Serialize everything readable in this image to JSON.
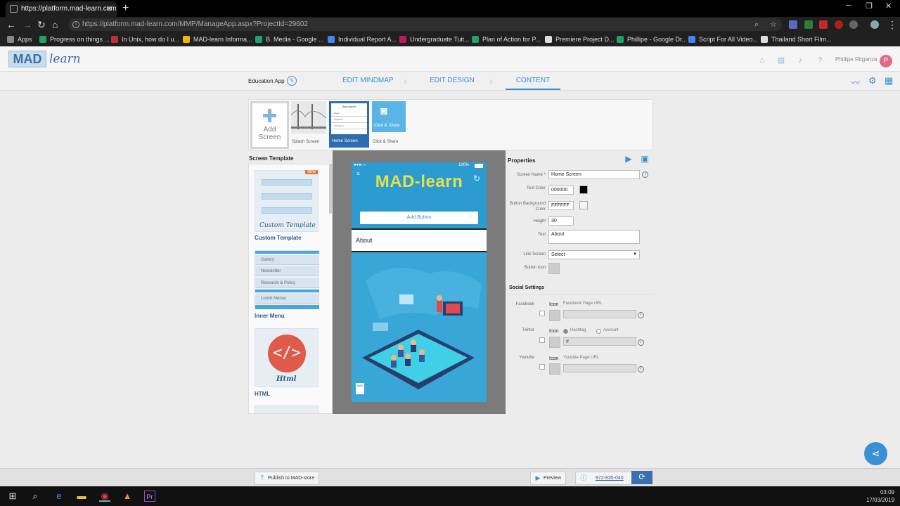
{
  "browser": {
    "tab_title": "https://platform.mad-learn.com/",
    "url": "https://platform.mad-learn.com/MMP/ManageApp.aspx?ProjectId=29602",
    "bookmarks": [
      {
        "label": "Apps",
        "color": "#888888"
      },
      {
        "label": "Progress on things ...",
        "color": "#1fa463"
      },
      {
        "label": "In Unix, how do I u...",
        "color": "#c03030"
      },
      {
        "label": "MAD-learn Informa...",
        "color": "#f4b400"
      },
      {
        "label": "B. Media - Google ...",
        "color": "#1fa463"
      },
      {
        "label": "Individual Report A...",
        "color": "#4285f4"
      },
      {
        "label": "Undergraduate Tuit...",
        "color": "#c2185b"
      },
      {
        "label": "Plan of Action for P...",
        "color": "#1fa463"
      },
      {
        "label": "Premiere Project D...",
        "color": "#dddddd"
      },
      {
        "label": "Phillipe - Google Dr...",
        "color": "#1fa463"
      },
      {
        "label": "Script For All Video...",
        "color": "#4285f4"
      },
      {
        "label": "Thailand Short Film...",
        "color": "#dddddd"
      }
    ]
  },
  "header": {
    "logo_mad": "MAD",
    "logo_learn": "learn",
    "user_name": "Phillipe Ritganza",
    "user_initial": "P"
  },
  "nav": {
    "app_name": "Education App",
    "steps": [
      "EDIT MINDMAP",
      "EDIT DESIGN",
      "CONTENT"
    ],
    "active_step": "CONTENT"
  },
  "screens": {
    "add_label": "Add Screen",
    "items": [
      {
        "caption": "Splash Screen"
      },
      {
        "caption": "Home Screen",
        "selected": true,
        "thumb_title": "App Name",
        "thumb_items": [
          "About",
          "Programs",
          "Contact Us"
        ]
      },
      {
        "caption": "Click & Share",
        "thumb_title": "Click & Share"
      }
    ]
  },
  "templates": {
    "heading": "Screen Template",
    "new_badge": "NEW",
    "custom_thumb_text": "Custom Template",
    "custom_label": "Custom Template",
    "inner_menu_items": [
      "Gallery",
      "Newsletter",
      "Research & Policy",
      "Lunch Menus"
    ],
    "inner_menu_label": "Inner Menu",
    "html_thumb_text": "Html",
    "html_label": "HTML"
  },
  "phone": {
    "status_signal": "●●●○○",
    "status_battery": "100%",
    "app_title": "MAD-learn",
    "add_button": "Add Button",
    "about_text": "About",
    "badge_text": "MAD"
  },
  "properties": {
    "heading": "Properties",
    "screen_name_label": "Screen Name",
    "screen_name_value": "Home Screen",
    "text_color_label": "Text Color",
    "text_color_value": "000000",
    "btn_bg_label": "Button Background Color",
    "btn_bg_value": "FFFFFF",
    "height_label": "Height",
    "height_value": "30",
    "text_label": "Text",
    "text_value": "About",
    "link_screen_label": "Link Screen",
    "link_screen_value": "Select",
    "button_icon_label": "Button Icon"
  },
  "social": {
    "heading": "Social Settings",
    "icon_label": "Icon",
    "facebook": {
      "name": "Facebook",
      "url_label": "Facebook Page URL",
      "value": ""
    },
    "twitter": {
      "name": "Twitter",
      "opt_hashtag": "Hashtag",
      "opt_account": "Account",
      "value": "#"
    },
    "youtube": {
      "name": "Youtube",
      "url_label": "Youtube Page URL",
      "value": ""
    }
  },
  "footer": {
    "publish_label": "Publish to MAD-store",
    "preview_label": "Preview",
    "code": "972-835-040"
  },
  "taskbar": {
    "time": "03:09",
    "date": "17/03/2019"
  },
  "colors": {
    "accent": "#3a8fd6",
    "phone_bg": "#2b9bd0",
    "title_yellow": "#e6e04a"
  }
}
